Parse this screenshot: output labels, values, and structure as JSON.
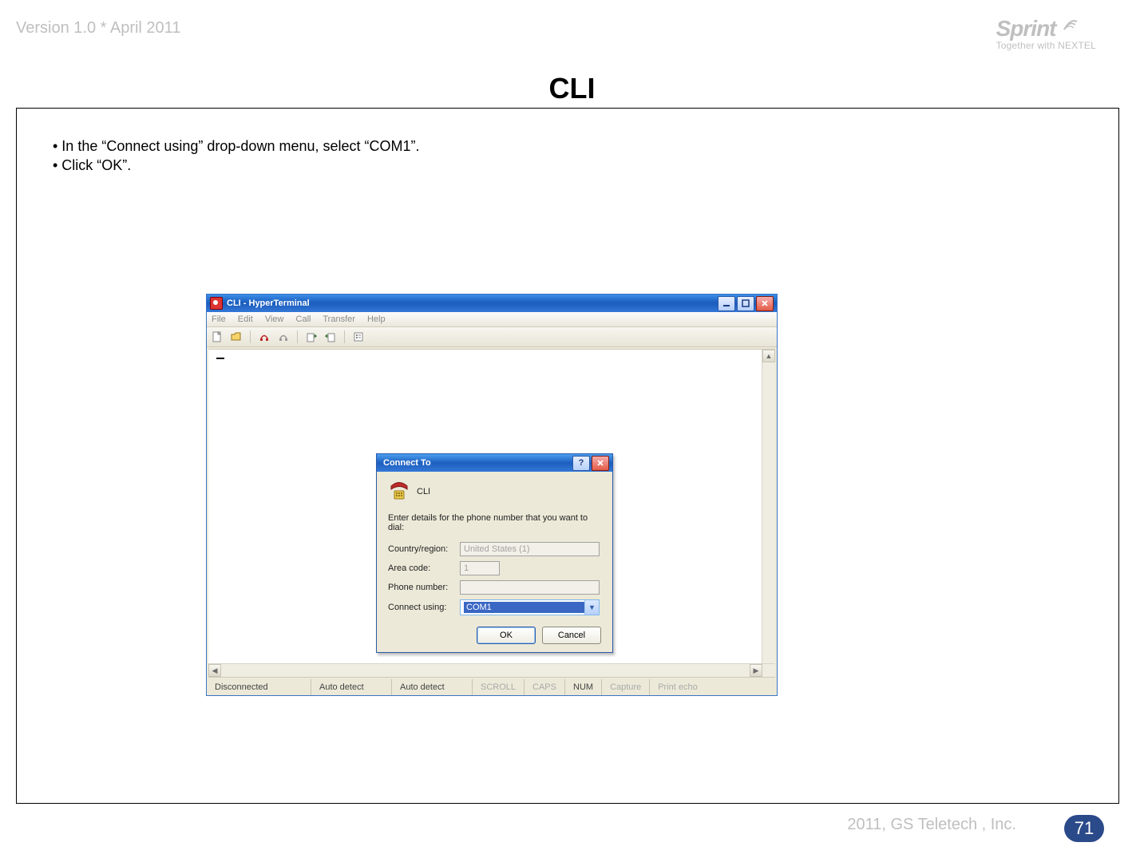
{
  "header": {
    "version_line": "Version 1.0 * April 2011"
  },
  "sprint": {
    "brand": "Sprint",
    "tagline": "Together with NEXTEL"
  },
  "title": "CLI",
  "instructions": {
    "line1": "• In the “Connect using” drop-down menu, select “COM1”.",
    "line2": "• Click “OK”."
  },
  "hyperterminal": {
    "window_title": "CLI - HyperTerminal",
    "menus": {
      "file": "File",
      "edit": "Edit",
      "view": "View",
      "call": "Call",
      "transfer": "Transfer",
      "help": "Help"
    },
    "status": {
      "conn": "Disconnected",
      "detect1": "Auto detect",
      "detect2": "Auto detect",
      "scroll": "SCROLL",
      "caps": "CAPS",
      "num": "NUM",
      "capture": "Capture",
      "printecho": "Print echo"
    }
  },
  "dialog": {
    "title": "Connect To",
    "conn_name": "CLI",
    "prompt": "Enter details for the phone number that you want to dial:",
    "labels": {
      "country": "Country/region:",
      "area": "Area code:",
      "phone": "Phone number:",
      "connect": "Connect using:"
    },
    "values": {
      "country": "United States (1)",
      "area": "1",
      "phone": "",
      "connect": "COM1"
    },
    "buttons": {
      "ok": "OK",
      "cancel": "Cancel"
    }
  },
  "footer": {
    "copyright": "2011, GS Teletech , Inc.",
    "page": "71"
  }
}
